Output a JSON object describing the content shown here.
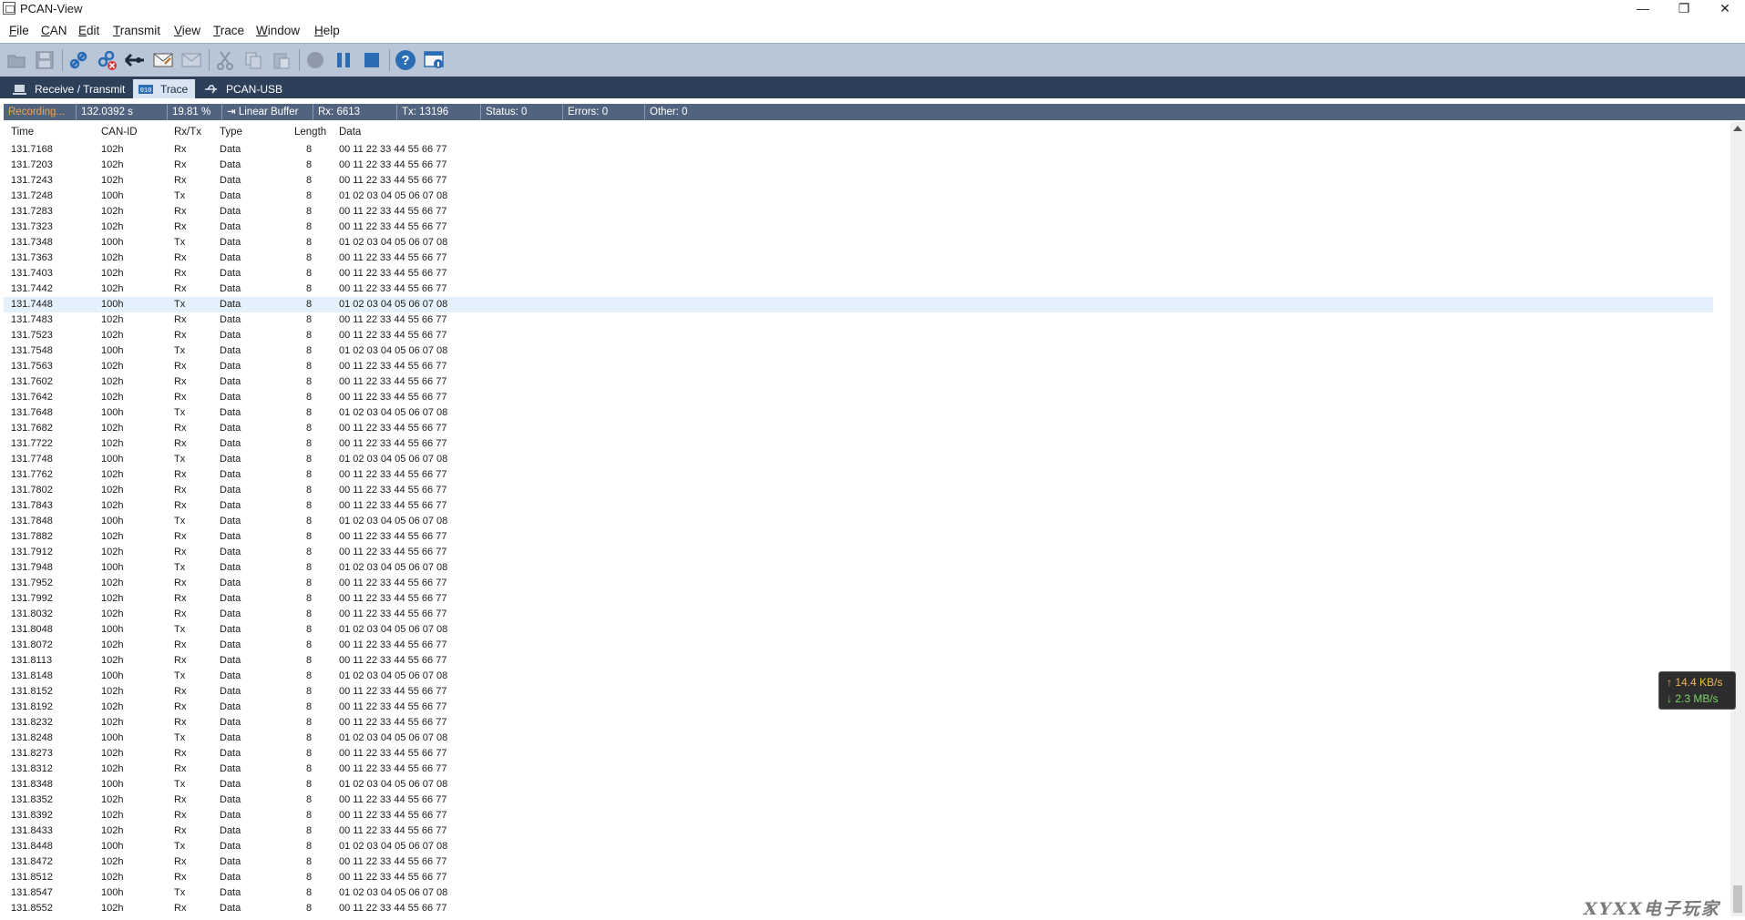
{
  "window": {
    "title": "PCAN-View"
  },
  "menu": [
    {
      "label": "File",
      "u": "F",
      "rest": "ile"
    },
    {
      "label": "CAN",
      "u": "C",
      "rest": "AN"
    },
    {
      "label": "Edit",
      "u": "E",
      "rest": "dit"
    },
    {
      "label": "Transmit",
      "u": "T",
      "rest": "ransmit"
    },
    {
      "label": "View",
      "u": "V",
      "rest": "iew"
    },
    {
      "label": "Trace",
      "u": "T",
      "rest": "race"
    },
    {
      "label": "Window",
      "u": "W",
      "rest": "indow"
    },
    {
      "label": "Help",
      "u": "H",
      "rest": "elp"
    }
  ],
  "toolbar": {
    "icons": [
      "open-folder-icon",
      "save-icon",
      "connect-icon",
      "disconnect-icon",
      "reset-icon",
      "new-message-icon",
      "edit-message-icon",
      "cut-icon",
      "copy-icon",
      "paste-icon",
      "record-icon",
      "pause-icon",
      "stop-icon",
      "help-icon",
      "about-icon"
    ]
  },
  "tabs": [
    {
      "label": "Receive / Transmit",
      "active": false
    },
    {
      "label": "Trace",
      "active": true
    },
    {
      "label": "PCAN-USB",
      "active": false
    }
  ],
  "status": {
    "state": "Recording...",
    "time": "132.0392 s",
    "buffer_fill": "19.81 %",
    "buffer_mode": "Linear Buffer",
    "rx": "Rx: 6613",
    "tx": "Tx: 13196",
    "status": "Status: 0",
    "errors": "Errors: 0",
    "other": "Other: 0"
  },
  "columns": [
    "Time",
    "CAN-ID",
    "Rx/Tx",
    "Type",
    "Length",
    "Data"
  ],
  "rows": [
    [
      "131.7168",
      "102h",
      "Rx",
      "Data",
      "8",
      "00 11 22 33 44 55 66 77"
    ],
    [
      "131.7203",
      "102h",
      "Rx",
      "Data",
      "8",
      "00 11 22 33 44 55 66 77"
    ],
    [
      "131.7243",
      "102h",
      "Rx",
      "Data",
      "8",
      "00 11 22 33 44 55 66 77"
    ],
    [
      "131.7248",
      "100h",
      "Tx",
      "Data",
      "8",
      "01 02 03 04 05 06 07 08"
    ],
    [
      "131.7283",
      "102h",
      "Rx",
      "Data",
      "8",
      "00 11 22 33 44 55 66 77"
    ],
    [
      "131.7323",
      "102h",
      "Rx",
      "Data",
      "8",
      "00 11 22 33 44 55 66 77"
    ],
    [
      "131.7348",
      "100h",
      "Tx",
      "Data",
      "8",
      "01 02 03 04 05 06 07 08"
    ],
    [
      "131.7363",
      "102h",
      "Rx",
      "Data",
      "8",
      "00 11 22 33 44 55 66 77"
    ],
    [
      "131.7403",
      "102h",
      "Rx",
      "Data",
      "8",
      "00 11 22 33 44 55 66 77"
    ],
    [
      "131.7442",
      "102h",
      "Rx",
      "Data",
      "8",
      "00 11 22 33 44 55 66 77"
    ],
    [
      "131.7448",
      "100h",
      "Tx",
      "Data",
      "8",
      "01 02 03 04 05 06 07 08"
    ],
    [
      "131.7483",
      "102h",
      "Rx",
      "Data",
      "8",
      "00 11 22 33 44 55 66 77"
    ],
    [
      "131.7523",
      "102h",
      "Rx",
      "Data",
      "8",
      "00 11 22 33 44 55 66 77"
    ],
    [
      "131.7548",
      "100h",
      "Tx",
      "Data",
      "8",
      "01 02 03 04 05 06 07 08"
    ],
    [
      "131.7563",
      "102h",
      "Rx",
      "Data",
      "8",
      "00 11 22 33 44 55 66 77"
    ],
    [
      "131.7602",
      "102h",
      "Rx",
      "Data",
      "8",
      "00 11 22 33 44 55 66 77"
    ],
    [
      "131.7642",
      "102h",
      "Rx",
      "Data",
      "8",
      "00 11 22 33 44 55 66 77"
    ],
    [
      "131.7648",
      "100h",
      "Tx",
      "Data",
      "8",
      "01 02 03 04 05 06 07 08"
    ],
    [
      "131.7682",
      "102h",
      "Rx",
      "Data",
      "8",
      "00 11 22 33 44 55 66 77"
    ],
    [
      "131.7722",
      "102h",
      "Rx",
      "Data",
      "8",
      "00 11 22 33 44 55 66 77"
    ],
    [
      "131.7748",
      "100h",
      "Tx",
      "Data",
      "8",
      "01 02 03 04 05 06 07 08"
    ],
    [
      "131.7762",
      "102h",
      "Rx",
      "Data",
      "8",
      "00 11 22 33 44 55 66 77"
    ],
    [
      "131.7802",
      "102h",
      "Rx",
      "Data",
      "8",
      "00 11 22 33 44 55 66 77"
    ],
    [
      "131.7843",
      "102h",
      "Rx",
      "Data",
      "8",
      "00 11 22 33 44 55 66 77"
    ],
    [
      "131.7848",
      "100h",
      "Tx",
      "Data",
      "8",
      "01 02 03 04 05 06 07 08"
    ],
    [
      "131.7882",
      "102h",
      "Rx",
      "Data",
      "8",
      "00 11 22 33 44 55 66 77"
    ],
    [
      "131.7912",
      "102h",
      "Rx",
      "Data",
      "8",
      "00 11 22 33 44 55 66 77"
    ],
    [
      "131.7948",
      "100h",
      "Tx",
      "Data",
      "8",
      "01 02 03 04 05 06 07 08"
    ],
    [
      "131.7952",
      "102h",
      "Rx",
      "Data",
      "8",
      "00 11 22 33 44 55 66 77"
    ],
    [
      "131.7992",
      "102h",
      "Rx",
      "Data",
      "8",
      "00 11 22 33 44 55 66 77"
    ],
    [
      "131.8032",
      "102h",
      "Rx",
      "Data",
      "8",
      "00 11 22 33 44 55 66 77"
    ],
    [
      "131.8048",
      "100h",
      "Tx",
      "Data",
      "8",
      "01 02 03 04 05 06 07 08"
    ],
    [
      "131.8072",
      "102h",
      "Rx",
      "Data",
      "8",
      "00 11 22 33 44 55 66 77"
    ],
    [
      "131.8113",
      "102h",
      "Rx",
      "Data",
      "8",
      "00 11 22 33 44 55 66 77"
    ],
    [
      "131.8148",
      "100h",
      "Tx",
      "Data",
      "8",
      "01 02 03 04 05 06 07 08"
    ],
    [
      "131.8152",
      "102h",
      "Rx",
      "Data",
      "8",
      "00 11 22 33 44 55 66 77"
    ],
    [
      "131.8192",
      "102h",
      "Rx",
      "Data",
      "8",
      "00 11 22 33 44 55 66 77"
    ],
    [
      "131.8232",
      "102h",
      "Rx",
      "Data",
      "8",
      "00 11 22 33 44 55 66 77"
    ],
    [
      "131.8248",
      "100h",
      "Tx",
      "Data",
      "8",
      "01 02 03 04 05 06 07 08"
    ],
    [
      "131.8273",
      "102h",
      "Rx",
      "Data",
      "8",
      "00 11 22 33 44 55 66 77"
    ],
    [
      "131.8312",
      "102h",
      "Rx",
      "Data",
      "8",
      "00 11 22 33 44 55 66 77"
    ],
    [
      "131.8348",
      "100h",
      "Tx",
      "Data",
      "8",
      "01 02 03 04 05 06 07 08"
    ],
    [
      "131.8352",
      "102h",
      "Rx",
      "Data",
      "8",
      "00 11 22 33 44 55 66 77"
    ],
    [
      "131.8392",
      "102h",
      "Rx",
      "Data",
      "8",
      "00 11 22 33 44 55 66 77"
    ],
    [
      "131.8433",
      "102h",
      "Rx",
      "Data",
      "8",
      "00 11 22 33 44 55 66 77"
    ],
    [
      "131.8448",
      "100h",
      "Tx",
      "Data",
      "8",
      "01 02 03 04 05 06 07 08"
    ],
    [
      "131.8472",
      "102h",
      "Rx",
      "Data",
      "8",
      "00 11 22 33 44 55 66 77"
    ],
    [
      "131.8512",
      "102h",
      "Rx",
      "Data",
      "8",
      "00 11 22 33 44 55 66 77"
    ],
    [
      "131.8547",
      "100h",
      "Tx",
      "Data",
      "8",
      "01 02 03 04 05 06 07 08"
    ],
    [
      "131.8552",
      "102h",
      "Rx",
      "Data",
      "8",
      "00 11 22 33 44 55 66 77"
    ]
  ],
  "highlighted_row": 10,
  "net_speed": {
    "up": "↑ 14.4 KB/s",
    "down": "↓ 2.3 MB/s"
  },
  "watermark": "XYXX电子玩家",
  "colors": {
    "toolbar_bg": "#b8c6d8",
    "tabstrip_bg": "#2e3f5a",
    "status_bg": "#51637e",
    "recording": "#f0a24a",
    "row_highlight": "#e4f0fb",
    "accent_blue": "#2a6db5"
  }
}
